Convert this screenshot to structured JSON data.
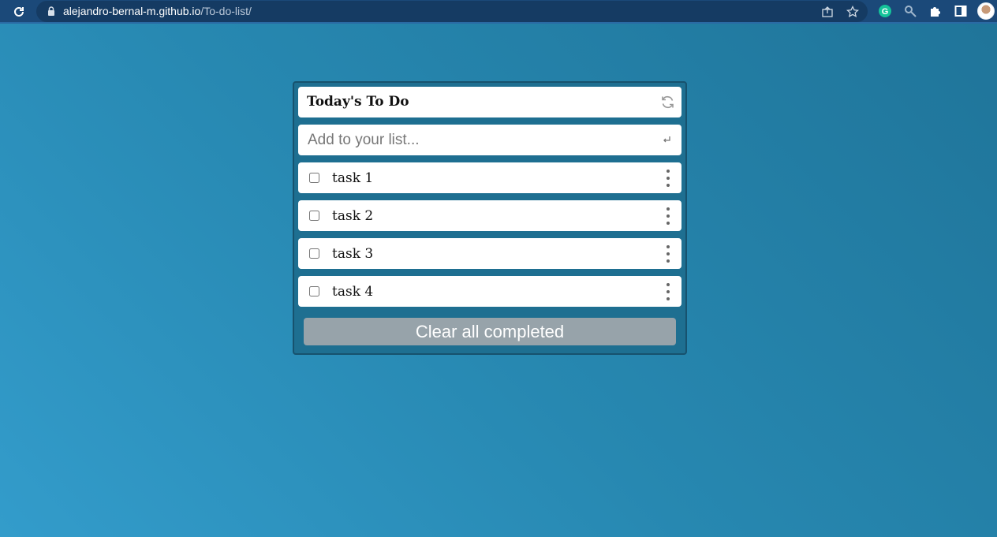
{
  "browser": {
    "url_domain": "alejandro-bernal-m.github.io",
    "url_path": "/To-do-list/",
    "icons": [
      "reload-icon",
      "lock-icon",
      "share-icon",
      "bookmark-star-icon",
      "grammarly-icon",
      "magnifier-extension-icon",
      "puzzle-extensions-icon",
      "side-panel-icon",
      "profile-avatar"
    ]
  },
  "todo": {
    "title": "Today's To Do",
    "input_placeholder": "Add to your list...",
    "input_value": "",
    "tasks": [
      {
        "label": "task 1",
        "completed": false
      },
      {
        "label": "task 2",
        "completed": false
      },
      {
        "label": "task 3",
        "completed": false
      },
      {
        "label": "task 4",
        "completed": false
      }
    ],
    "clear_button_label": "Clear all completed"
  },
  "colors": {
    "background_start": "#339ccb",
    "background_end": "#1f7499",
    "card_bg": "#1e6f91",
    "clear_button_bg": "#97a3aa",
    "browser_bar": "#1b4979"
  }
}
